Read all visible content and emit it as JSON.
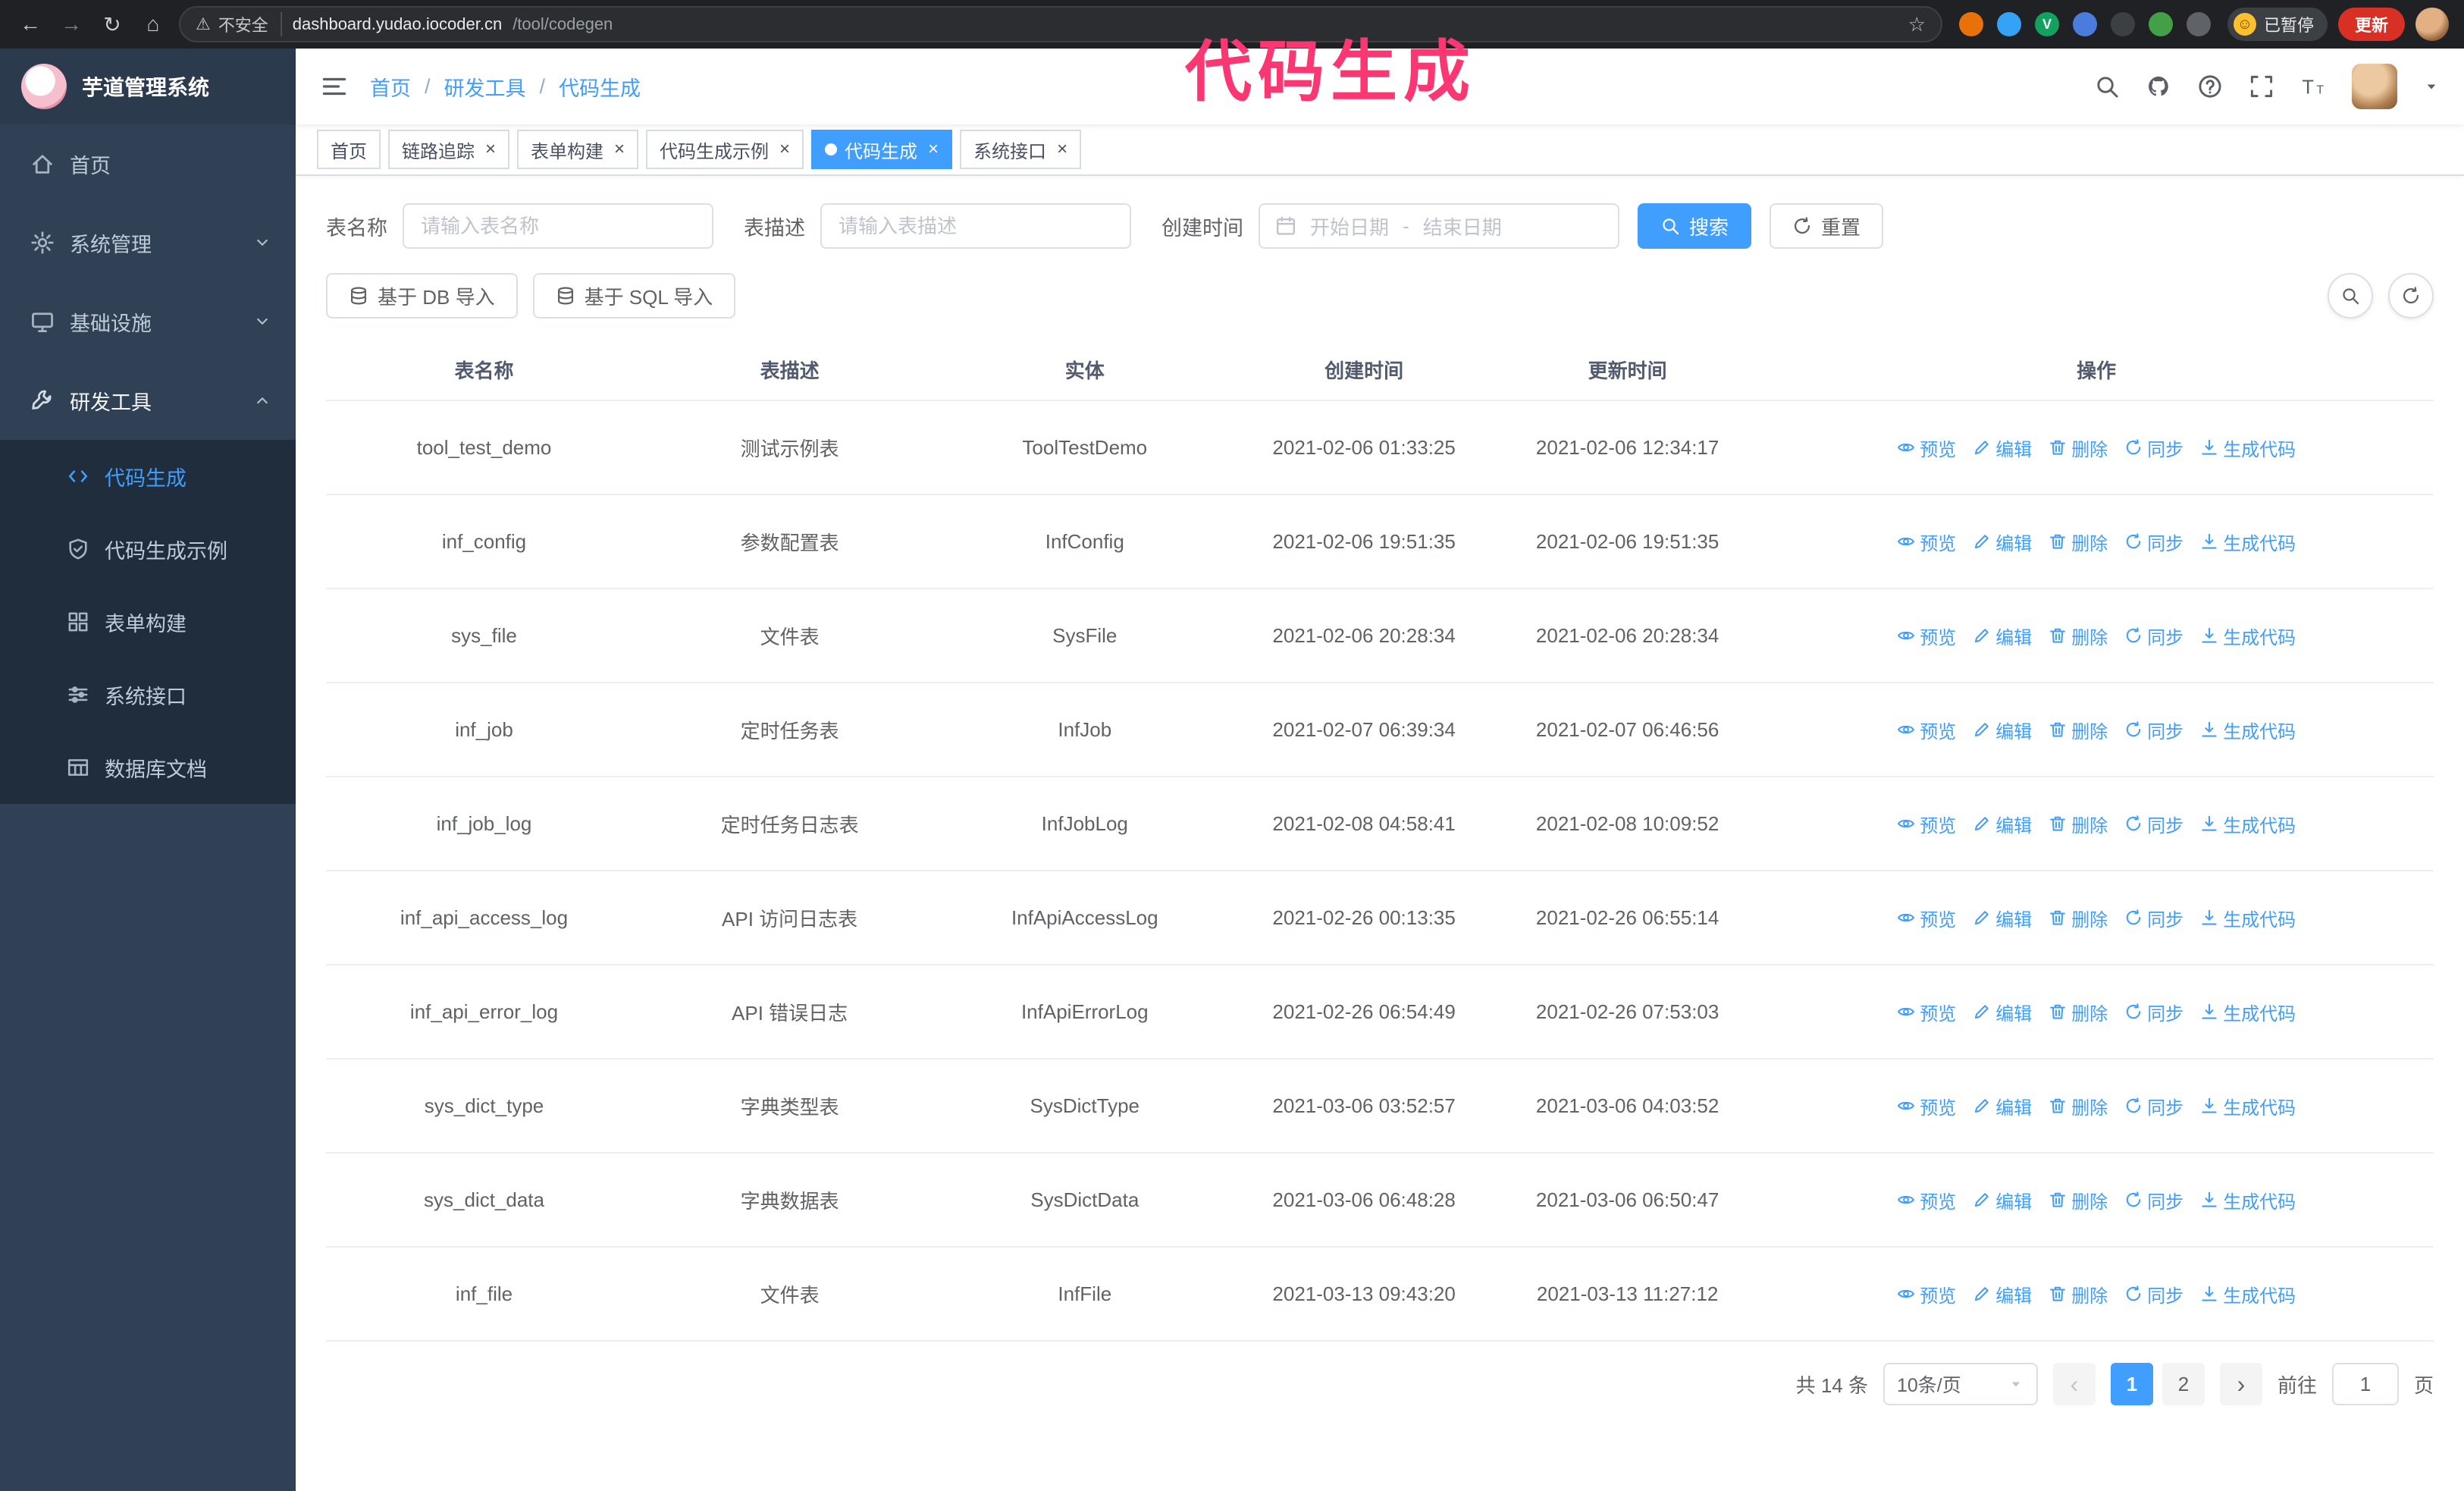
{
  "browser": {
    "security_label": "不安全",
    "url_host": "dashboard.yudao.iocoder.cn",
    "url_path": "/tool/codegen",
    "paused_badge": "已暂停",
    "update_button": "更新",
    "extensions": [
      {
        "color": "#e8710a"
      },
      {
        "color": "#35a3f5"
      },
      {
        "color": "#12a15e",
        "glyph": "V"
      },
      {
        "color": "#4a7ddb"
      },
      {
        "color": "#3c4043"
      },
      {
        "color": "#43a047"
      },
      {
        "color": "#5f6368"
      }
    ]
  },
  "annotation": {
    "text": "代码生成",
    "color": "#fa3773"
  },
  "sidebar": {
    "logo_title": "芋道管理系统",
    "items": [
      {
        "key": "home",
        "label": "首页",
        "icon": "home",
        "expandable": false
      },
      {
        "key": "system",
        "label": "系统管理",
        "icon": "gear",
        "expandable": true,
        "expanded": false
      },
      {
        "key": "infra",
        "label": "基础设施",
        "icon": "monitor",
        "expandable": true,
        "expanded": false
      },
      {
        "key": "devtools",
        "label": "研发工具",
        "icon": "tools",
        "expandable": true,
        "expanded": true
      }
    ],
    "subitems": [
      {
        "key": "codegen",
        "label": "代码生成",
        "icon": "code",
        "active": true
      },
      {
        "key": "codegen-example",
        "label": "代码生成示例",
        "icon": "shield",
        "active": false
      },
      {
        "key": "form-builder",
        "label": "表单构建",
        "icon": "grid",
        "active": false
      },
      {
        "key": "system-api",
        "label": "系统接口",
        "icon": "sliders",
        "active": false
      },
      {
        "key": "db-doc",
        "label": "数据库文档",
        "icon": "table",
        "active": false
      }
    ]
  },
  "navbar": {
    "breadcrumb": [
      "首页",
      "研发工具",
      "代码生成"
    ],
    "separator": "/"
  },
  "tabs": [
    {
      "label": "首页",
      "closable": false,
      "active": false
    },
    {
      "label": "链路追踪",
      "closable": true,
      "active": false
    },
    {
      "label": "表单构建",
      "closable": true,
      "active": false
    },
    {
      "label": "代码生成示例",
      "closable": true,
      "active": false
    },
    {
      "label": "代码生成",
      "closable": true,
      "active": true
    },
    {
      "label": "系统接口",
      "closable": true,
      "active": false
    }
  ],
  "search_form": {
    "table_name_label": "表名称",
    "table_name_placeholder": "请输入表名称",
    "table_desc_label": "表描述",
    "table_desc_placeholder": "请输入表描述",
    "create_time_label": "创建时间",
    "date_start_placeholder": "开始日期",
    "date_separator": "-",
    "date_end_placeholder": "结束日期",
    "search_button": "搜索",
    "reset_button": "重置"
  },
  "toolbar": {
    "import_db_button": "基于 DB 导入",
    "import_sql_button": "基于 SQL 导入"
  },
  "table": {
    "columns": [
      "表名称",
      "表描述",
      "实体",
      "创建时间",
      "更新时间",
      "操作"
    ],
    "actions": [
      {
        "key": "preview",
        "label": "预览",
        "icon": "eye"
      },
      {
        "key": "edit",
        "label": "编辑",
        "icon": "edit"
      },
      {
        "key": "delete",
        "label": "删除",
        "icon": "trash"
      },
      {
        "key": "sync",
        "label": "同步",
        "icon": "sync"
      },
      {
        "key": "generate-code",
        "label": "生成代码",
        "icon": "download"
      }
    ],
    "rows": [
      {
        "name": "tool_test_demo",
        "desc": "测试示例表",
        "entity": "ToolTestDemo",
        "created": "2021-02-06 01:33:25",
        "updated": "2021-02-06 12:34:17"
      },
      {
        "name": "inf_config",
        "desc": "参数配置表",
        "entity": "InfConfig",
        "created": "2021-02-06 19:51:35",
        "updated": "2021-02-06 19:51:35"
      },
      {
        "name": "sys_file",
        "desc": "文件表",
        "entity": "SysFile",
        "created": "2021-02-06 20:28:34",
        "updated": "2021-02-06 20:28:34"
      },
      {
        "name": "inf_job",
        "desc": "定时任务表",
        "entity": "InfJob",
        "created": "2021-02-07 06:39:34",
        "updated": "2021-02-07 06:46:56"
      },
      {
        "name": "inf_job_log",
        "desc": "定时任务日志表",
        "entity": "InfJobLog",
        "created": "2021-02-08 04:58:41",
        "updated": "2021-02-08 10:09:52"
      },
      {
        "name": "inf_api_access_log",
        "desc": "API 访问日志表",
        "entity": "InfApiAccessLog",
        "created": "2021-02-26 00:13:35",
        "updated": "2021-02-26 06:55:14"
      },
      {
        "name": "inf_api_error_log",
        "desc": "API 错误日志",
        "entity": "InfApiErrorLog",
        "created": "2021-02-26 06:54:49",
        "updated": "2021-02-26 07:53:03"
      },
      {
        "name": "sys_dict_type",
        "desc": "字典类型表",
        "entity": "SysDictType",
        "created": "2021-03-06 03:52:57",
        "updated": "2021-03-06 04:03:52"
      },
      {
        "name": "sys_dict_data",
        "desc": "字典数据表",
        "entity": "SysDictData",
        "created": "2021-03-06 06:48:28",
        "updated": "2021-03-06 06:50:47"
      },
      {
        "name": "inf_file",
        "desc": "文件表",
        "entity": "InfFile",
        "created": "2021-03-13 09:43:20",
        "updated": "2021-03-13 11:27:12"
      }
    ]
  },
  "pagination": {
    "total_text": "共 14 条",
    "page_size": "10条/页",
    "pages": [
      "1",
      "2"
    ],
    "active_page": "1",
    "goto_label": "前往",
    "goto_value": "1",
    "goto_suffix": "页"
  },
  "colors": {
    "accent": "#409EFF",
    "sidebar_bg": "#304156",
    "submenu_bg": "#1f2d3d",
    "chrome_bg": "#1f2125",
    "update_red": "#d93025",
    "annotation_pink": "#fa3773"
  }
}
